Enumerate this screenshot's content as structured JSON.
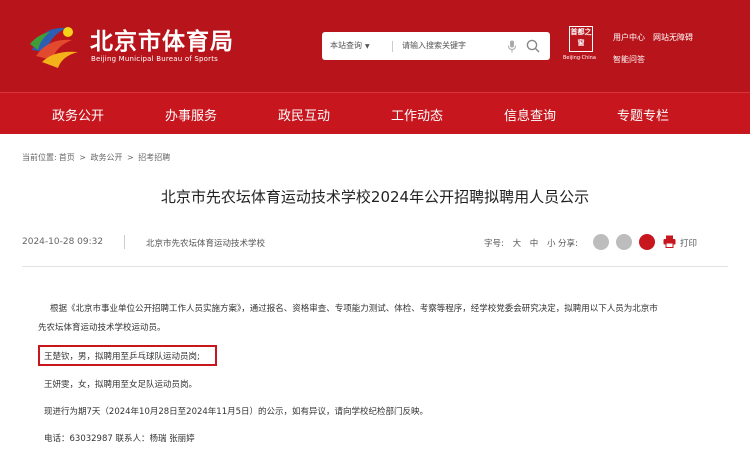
{
  "header": {
    "site_title": "北京市体育局",
    "site_subtitle": "Beijing Municipal Bureau of Sports",
    "search": {
      "scope_label": "本站查询",
      "placeholder": "请输入搜索关键字"
    },
    "seal": {
      "chars": "首都之窗",
      "caption": "Beijing·China"
    },
    "links": {
      "user_center": "用户中心",
      "accessible": "网站无障碍",
      "smart_qa": "智能问答"
    }
  },
  "nav": [
    "政务公开",
    "办事服务",
    "政民互动",
    "工作动态",
    "信息查询",
    "专题专栏"
  ],
  "breadcrumb": {
    "prefix": "当前位置:",
    "items": [
      "首页",
      "政务公开",
      "招考招聘"
    ],
    "separator": ">"
  },
  "article": {
    "title": "北京市先农坛体育运动技术学校2024年公开招聘拟聘用人员公示",
    "date": "2024-10-28 09:32",
    "source": "北京市先农坛体育运动技术学校",
    "font_label": "字号:",
    "font_sizes": [
      "大",
      "中",
      "小"
    ],
    "share_label": "分享:",
    "print_label": "打印",
    "paragraphs": {
      "intro_line1": "根据《北京市事业单位公开招聘工作人员实施方案》，通过报名、资格审查、专项能力测试、体检、考察等程序，经学校党委会研究决定，拟聘用以下人员为北京市",
      "intro_line2": "先农坛体育运动技术学校运动员。",
      "person1": "王楚钦，男，拟聘用至乒乓球队运动员岗;",
      "person2": "王妍雯，女，拟聘用至女足队运动员岗。",
      "notice": "现进行为期7天（2024年10月28日至2024年11月5日）的公示，如有异议，请向学校纪检部门反映。",
      "contact": "电话：63032987    联系人：杨瑞 张丽婷"
    }
  },
  "colors": {
    "header_red": "#b8141b",
    "nav_red": "#c7161e",
    "highlight_red": "#c8161e"
  }
}
